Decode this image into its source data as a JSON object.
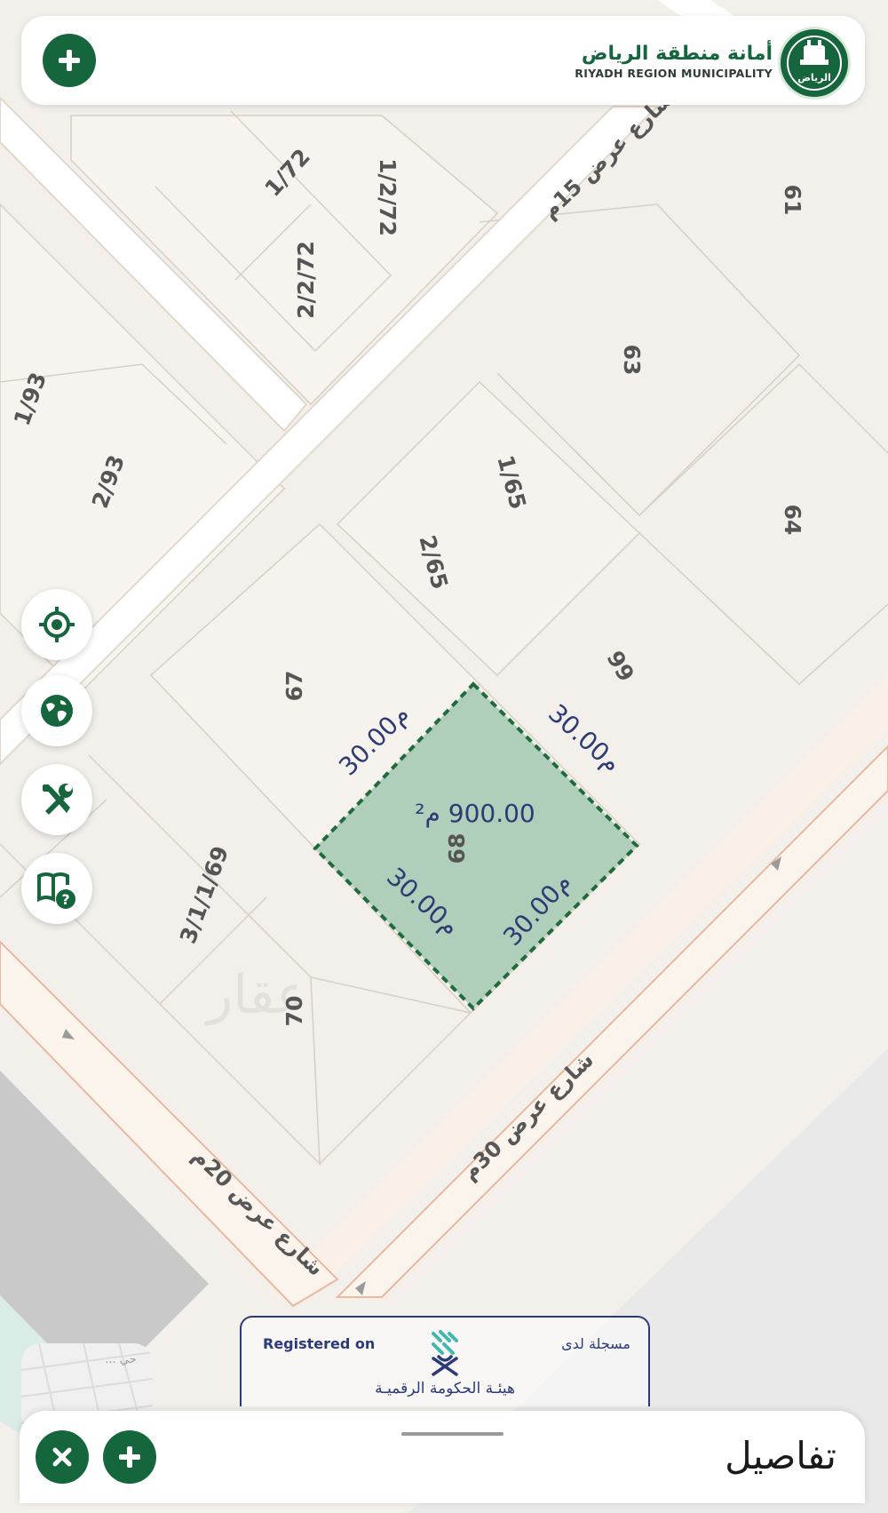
{
  "header": {
    "municipality_ar": "أمانة منطقة الرياض",
    "municipality_en": "RIYADH REGION MUNICIPALITY",
    "logo_text": "الرياض"
  },
  "map": {
    "parcels": [
      {
        "label": "1/72"
      },
      {
        "label": "1/2/72"
      },
      {
        "label": "2/2/72"
      },
      {
        "label": "61"
      },
      {
        "label": "63"
      },
      {
        "label": "1/93"
      },
      {
        "label": "2/93"
      },
      {
        "label": "1/65"
      },
      {
        "label": "64"
      },
      {
        "label": "2/65"
      },
      {
        "label": "67"
      },
      {
        "label": "66"
      },
      {
        "label": "3/1/1/69"
      },
      {
        "label": "68"
      },
      {
        "label": "70"
      }
    ],
    "streets": [
      {
        "label": "شارع عرض 15م"
      },
      {
        "label": "شارع عرض 30م"
      },
      {
        "label": "شارع عرض 20م"
      }
    ],
    "selected_parcel": {
      "area": "900.00 م²",
      "dimensions": [
        "30.00م",
        "30.00م",
        "30.00م",
        "30.00م"
      ]
    },
    "watermark": "عقار"
  },
  "tools": [
    "locate-icon",
    "globe-icon",
    "tools-icon",
    "help-book-icon"
  ],
  "registration": {
    "registered_on": "Registered on",
    "registered_on_ar": "مسجلة لدى",
    "authority_ar": "هيئـة الحكومة الرقميـة"
  },
  "minimap": {
    "label": "حي ..."
  },
  "bottom_sheet": {
    "title": "تفاصيل"
  },
  "colors": {
    "brand_green": "#15663d",
    "parcel_fill": "#a9cbb5",
    "dimension_text": "#2d3b74"
  }
}
